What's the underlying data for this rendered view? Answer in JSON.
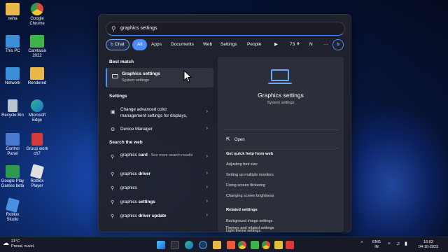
{
  "desktop_icons": [
    {
      "label": "neha",
      "icon": "folder-icon",
      "color": "#e8b84a"
    },
    {
      "label": "Google Chrome",
      "icon": "chrome-icon",
      "color": "#e04a3a"
    },
    {
      "label": "This PC",
      "icon": "monitor-icon",
      "color": "#3a8fd8"
    },
    {
      "label": "Camtasia 2022",
      "icon": "camtasia-icon",
      "color": "#3db34a"
    },
    {
      "label": "Network",
      "icon": "network-icon",
      "color": "#3a8fd8"
    },
    {
      "label": "Rendered",
      "icon": "folder-icon",
      "color": "#e8b84a"
    },
    {
      "label": "Recycle Bin",
      "icon": "recycle-bin-icon",
      "color": "#b8c4d0"
    },
    {
      "label": "Microsoft Edge",
      "icon": "edge-icon",
      "color": "#2fb88a"
    },
    {
      "label": "Control Panel",
      "icon": "control-panel-icon",
      "color": "#4a7ad0"
    },
    {
      "label": "Group work ch7",
      "icon": "pdf-icon",
      "color": "#d83a3a"
    },
    {
      "label": "Google Play Games beta",
      "icon": "play-games-icon",
      "color": "#2e9a4e"
    },
    {
      "label": "Roblox Player",
      "icon": "roblox-icon",
      "color": "#e0e0e0"
    },
    {
      "label": "Roblox Studio",
      "icon": "roblox-studio-icon",
      "color": "#4a90e0"
    }
  ],
  "search": {
    "query": "graphics settings"
  },
  "filters": [
    "Chat",
    "All",
    "Apps",
    "Documents",
    "Web",
    "Settings",
    "People"
  ],
  "filter_extra": {
    "play": "▶",
    "count": "73",
    "user_initial": "N",
    "more": "···",
    "bing": "b"
  },
  "left": {
    "best_match_header": "Best match",
    "best_match": {
      "title": "Graphics settings",
      "subtitle": "System settings"
    },
    "settings_header": "Settings",
    "settings_items": [
      {
        "line1": "Change advanced color",
        "line2": "management settings for displays,"
      },
      {
        "line1": "Device Manager",
        "line2": ""
      }
    ],
    "web_header": "Search the web",
    "web_items": [
      {
        "bold": "",
        "normal": "graphics ",
        "boldtail": "card",
        "dim": " - See more search results"
      },
      {
        "bold": "",
        "normal": "graphics ",
        "boldtail": "driver",
        "dim": ""
      },
      {
        "bold": "",
        "normal": "graphics",
        "boldtail": "",
        "dim": ""
      },
      {
        "bold": "",
        "normal": "graphics ",
        "boldtail": "settings",
        "dim": ""
      },
      {
        "bold": "",
        "normal": "graphics ",
        "boldtail": "driver update",
        "dim": ""
      }
    ]
  },
  "right": {
    "title": "Graphics settings",
    "subtitle": "System settings",
    "open_label": "Open",
    "help_header": "Get quick help from web",
    "help_links": [
      "Adjusting font size",
      "Setting up multiple monitors",
      "Fixing screen flickering",
      "Changing screen brightness"
    ],
    "related_header": "Related settings",
    "related_links": [
      "Background image settings",
      "Light theme settings",
      "Themes and related settings"
    ]
  },
  "taskbar": {
    "weather_temp": "21°C",
    "weather_desc": "Preval. nuvol.",
    "lang_line1": "ENG",
    "lang_line2": "IN",
    "time": "16:03",
    "date": "04-10-2023"
  }
}
